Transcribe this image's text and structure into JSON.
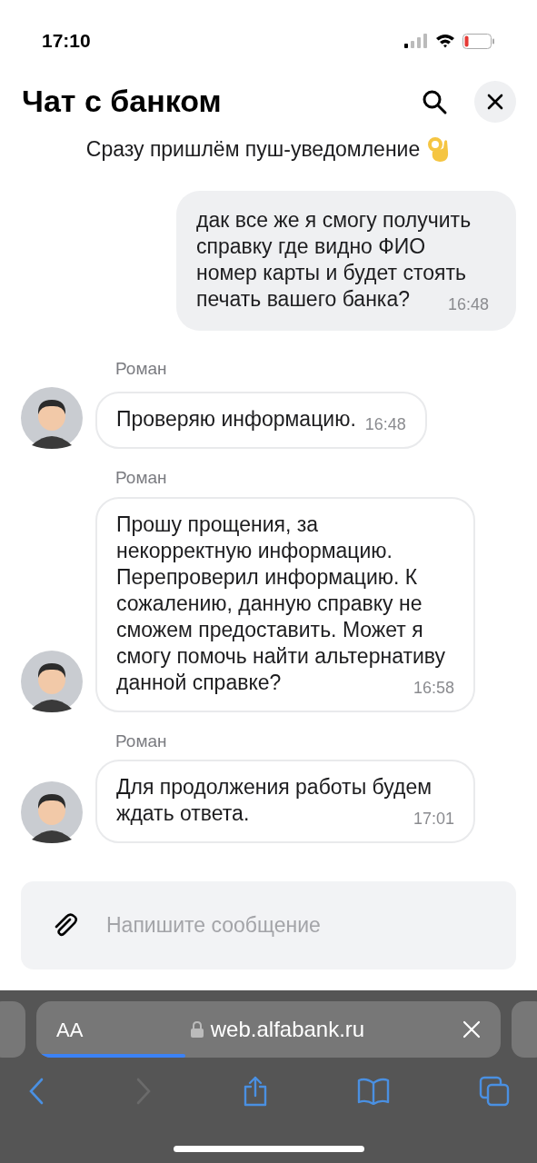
{
  "status_bar": {
    "time": "17:10"
  },
  "header": {
    "title": "Чат с банком"
  },
  "notice": "Сразу пришлём пуш-уведомление",
  "messages": [
    {
      "kind": "outgoing",
      "text": "дак все же я смогу получить справку где видно ФИО номер карты и будет стоять печать вашего банка?",
      "time": "16:48"
    },
    {
      "kind": "incoming",
      "author": "Роман",
      "text": "Проверяю информацию.",
      "time": "16:48"
    },
    {
      "kind": "incoming",
      "author": "Роман",
      "text": "Прошу прощения, за некорректную информацию. Перепроверил информацию. К сожалению, данную справку не сможем предоставить. Может я смогу помочь найти альтернативу данной справке?",
      "time": "16:58"
    },
    {
      "kind": "incoming",
      "author": "Роман",
      "text": "Для продолжения работы будем ждать ответа.",
      "time": "17:01"
    }
  ],
  "composer": {
    "placeholder": "Напишите сообщение"
  },
  "browser": {
    "text_size_button": "AA",
    "url": "web.alfabank.ru",
    "load_progress": {
      "level": 0.32
    },
    "forward_disabled": true
  }
}
